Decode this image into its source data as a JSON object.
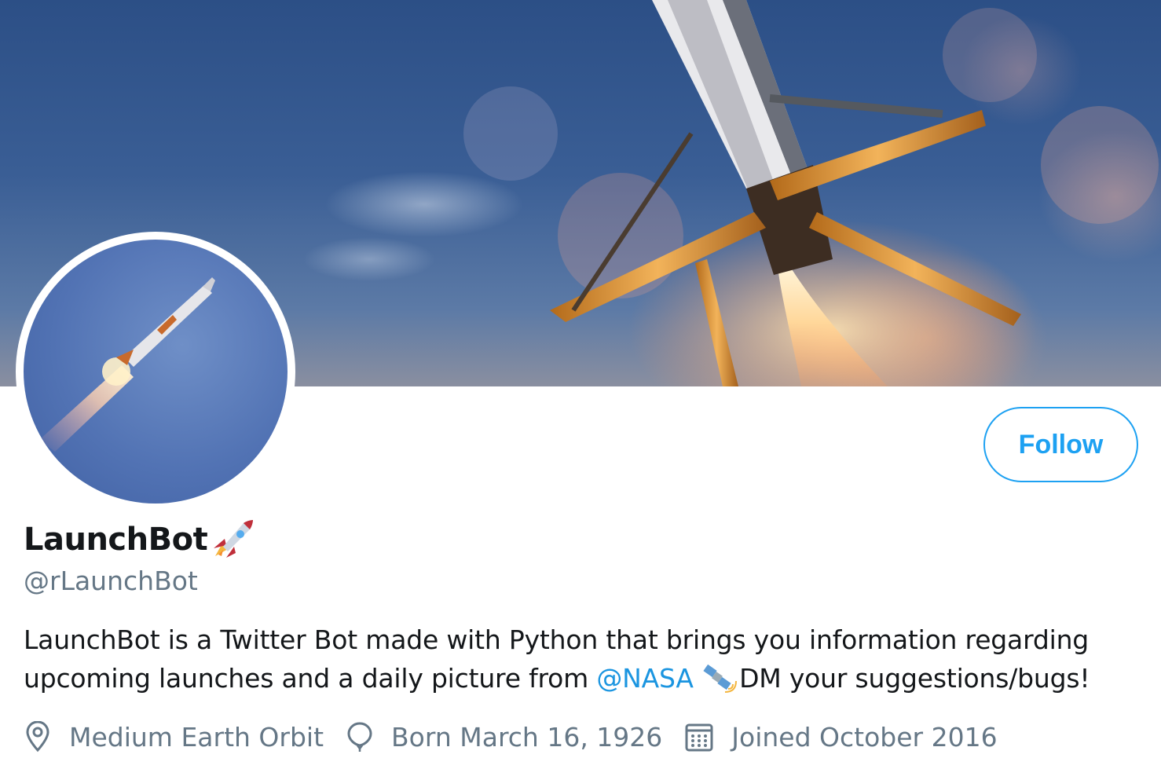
{
  "profile": {
    "display_name": "LaunchBot",
    "handle": "@rLaunchBot",
    "follow_label": "Follow",
    "bio": {
      "part1": "LaunchBot is a Twitter Bot made with Python that brings you information regarding upcoming launches and a daily picture from ",
      "mention": "@NASA",
      "part2": "DM your suggestions/bugs!"
    },
    "location": "Medium Earth Orbit",
    "birthday": "Born March 16, 1926",
    "joined": "Joined October 2016"
  },
  "icons": {
    "name_emoji": "rocket-icon",
    "bio_emoji": "satellite-icon",
    "location": "location-pin-icon",
    "birthday": "balloon-icon",
    "joined": "calendar-icon"
  },
  "colors": {
    "accent": "#1da1f2",
    "mention": "#1b95e0",
    "secondary_text": "#657786",
    "primary_text": "#14171a"
  }
}
